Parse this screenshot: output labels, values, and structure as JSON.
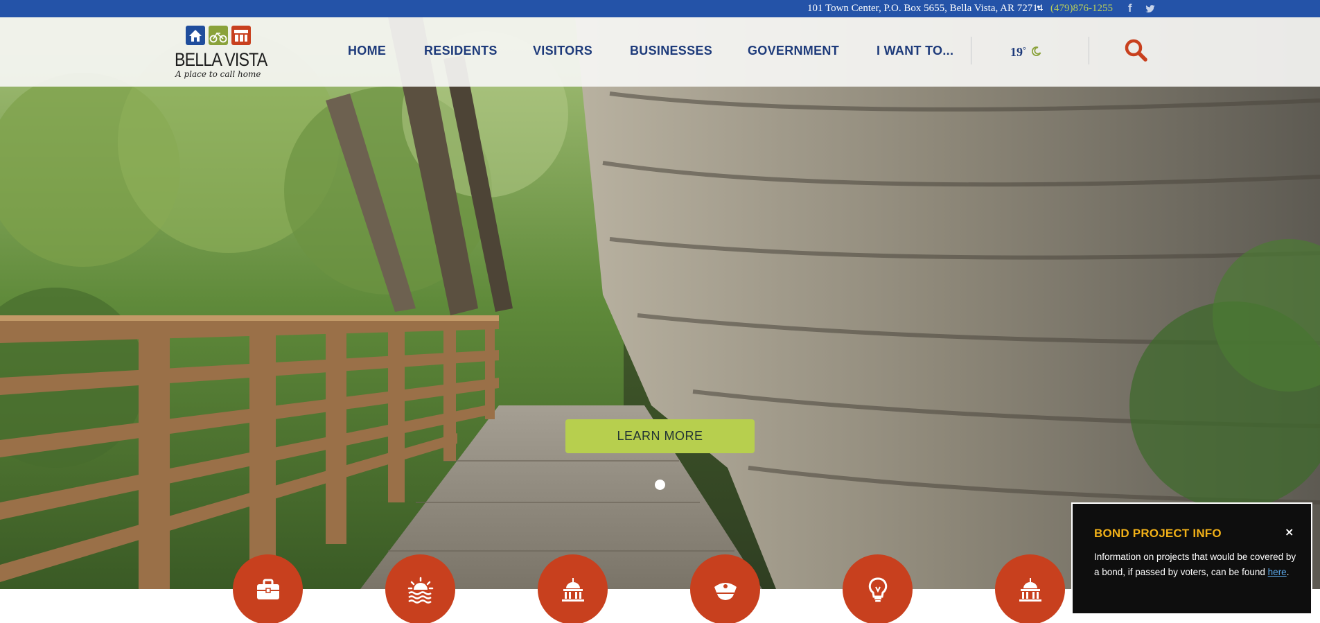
{
  "topbar": {
    "address": "101 Town Center, P.O. Box 5655, Bella Vista, AR 72714",
    "separator": "•",
    "phone": "(479)876-1255",
    "social": [
      "facebook-icon",
      "twitter-icon"
    ]
  },
  "logo": {
    "name": "BELLA VISTA",
    "tagline": "A place to call home",
    "tiles": [
      "house-icon",
      "bicycle-icon",
      "storefront-icon"
    ]
  },
  "nav": {
    "items": [
      "HOME",
      "RESIDENTS",
      "VISITORS",
      "BUSINESSES",
      "GOVERNMENT",
      "I WANT TO..."
    ]
  },
  "weather": {
    "temperature": "19",
    "unit": "°",
    "icon": "moon-icon"
  },
  "search": {
    "icon": "search-icon"
  },
  "hero": {
    "cta_label": "LEARN MORE",
    "slides": 1,
    "active_slide": 1
  },
  "quick_links": {
    "icons": [
      "briefcase-icon",
      "sunset-water-icon",
      "capitol-building-icon",
      "police-cap-icon",
      "lightbulb-icon",
      "capitol-building-icon"
    ]
  },
  "popup": {
    "title": "BOND PROJECT INFO",
    "close": "×",
    "text_before": "Information on projects that would be covered by a bond, if passed by voters, can be found ",
    "link_text": "here",
    "text_after": "."
  },
  "colors": {
    "topbar": "#2453a8",
    "nav_text": "#1d3a7a",
    "accent_green": "#b7cf4e",
    "icon_circle": "#c8401e",
    "popup_title": "#f2b118"
  }
}
